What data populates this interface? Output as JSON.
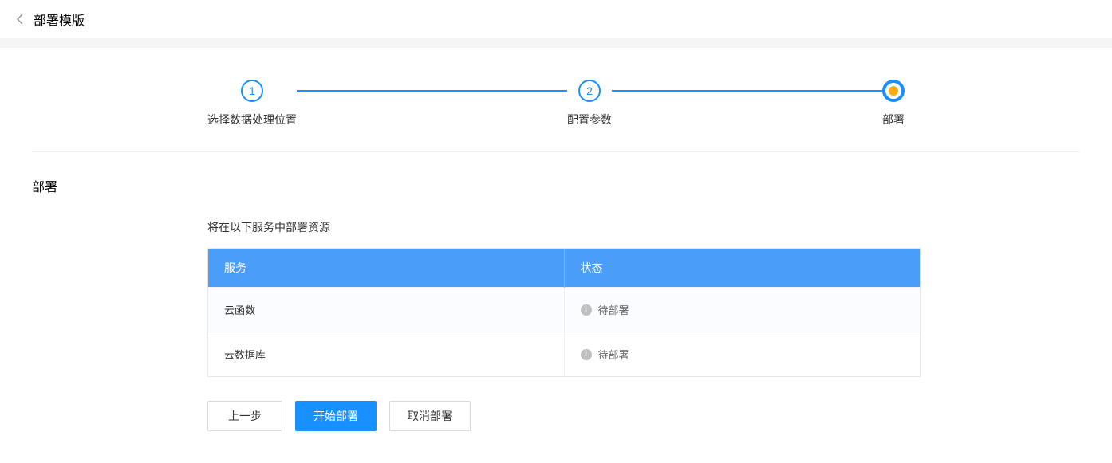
{
  "header": {
    "title": "部署模版"
  },
  "steps": [
    {
      "num": "1",
      "label": "选择数据处理位置"
    },
    {
      "num": "2",
      "label": "配置参数"
    },
    {
      "num": "",
      "label": "部署"
    }
  ],
  "section": {
    "title": "部署",
    "subtitle": "将在以下服务中部署资源"
  },
  "table": {
    "headers": {
      "service": "服务",
      "status": "状态"
    },
    "rows": [
      {
        "service": "云函数",
        "status": "待部署"
      },
      {
        "service": "云数据库",
        "status": "待部署"
      }
    ]
  },
  "buttons": {
    "prev": "上一步",
    "start": "开始部署",
    "cancel": "取消部署"
  }
}
